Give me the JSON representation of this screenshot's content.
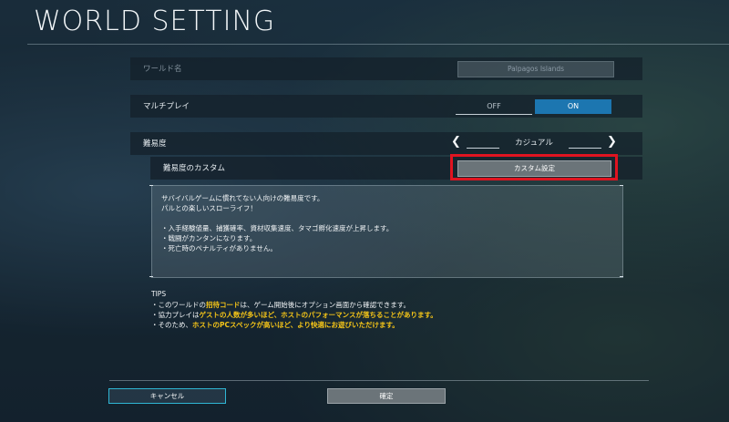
{
  "header": {
    "title": "WORLD SETTING"
  },
  "world_name": {
    "label": "ワールド名",
    "value": "Palpagos Islands"
  },
  "multiplay": {
    "label": "マルチプレイ",
    "off_label": "OFF",
    "on_label": "ON",
    "selected": "ON"
  },
  "difficulty": {
    "label": "難易度",
    "value": "カジュアル"
  },
  "custom": {
    "label": "難易度のカスタム",
    "button_label": "カスタム設定"
  },
  "description": {
    "lines": [
      "サバイバルゲームに慣れてない人向けの難易度です。",
      "パルとの楽しいスローライフ！",
      "",
      "・入手経験値量、捕獲確率、資材収集速度、タマゴ孵化速度が上昇します。",
      "・戦闘がカンタンになります。",
      "・死亡時のペナルティがありません。"
    ]
  },
  "tips": {
    "heading": "TIPS",
    "line1": {
      "a": "・このワールドの",
      "b": "招待コード",
      "c": "は、ゲーム開始後にオプション画面から確認できます。"
    },
    "line2": {
      "a": "・協力プレイは",
      "b": "ゲストの人数が多いほど、ホストのパフォーマンスが落ちることがあります。"
    },
    "line3": {
      "a": "・そのため、",
      "b": "ホストのPCスペックが高いほど、より快適にお遊びいただけます。"
    }
  },
  "footer": {
    "cancel_label": "キャンセル",
    "confirm_label": "確定"
  },
  "colors": {
    "accent": "#1c76b0",
    "highlight_border": "#e01420",
    "tips_highlight": "#f5c518",
    "cancel_border": "#2fb6d4"
  }
}
